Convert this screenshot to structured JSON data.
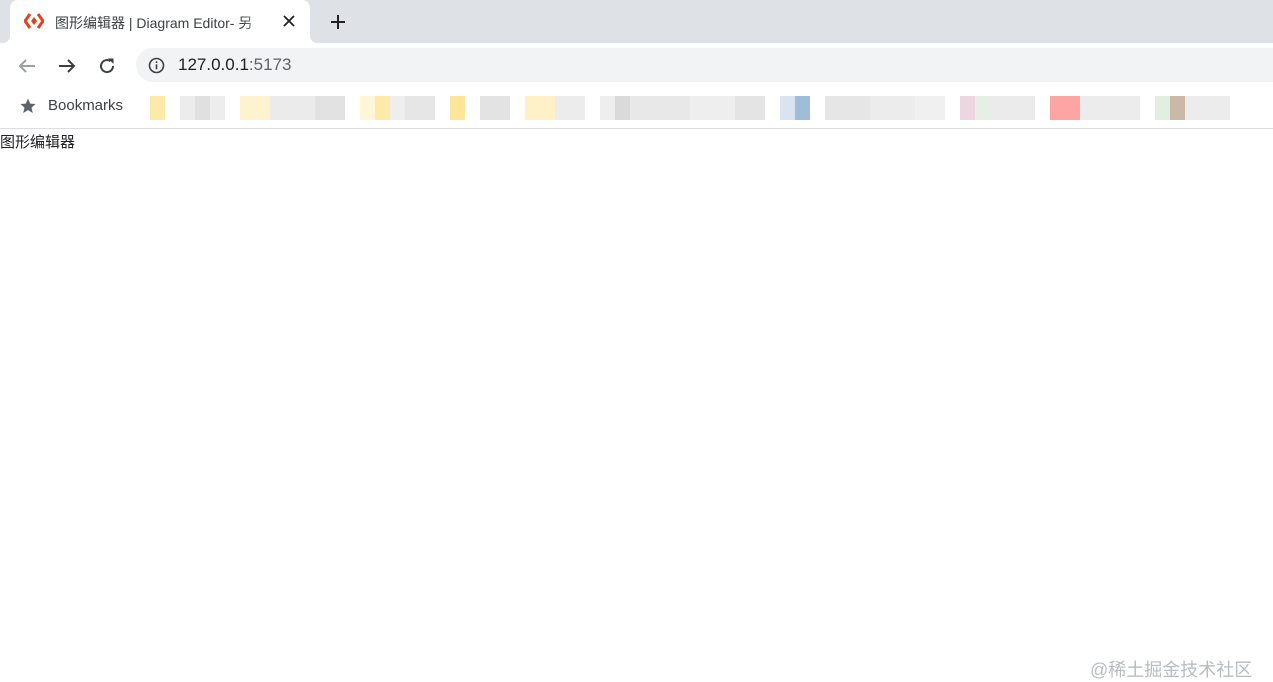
{
  "browser": {
    "tab": {
      "title": "图形编辑器 | Diagram Editor- 另",
      "favicon_icon": "diagram-logo-icon",
      "close_icon": "close-icon"
    },
    "new_tab_icon": "plus-icon",
    "toolbar": {
      "back_icon": "arrow-left-icon",
      "forward_icon": "arrow-right-icon",
      "reload_icon": "reload-icon",
      "site_info_icon": "info-icon",
      "url_host": "127.0.0.1",
      "url_port": ":5173"
    },
    "bookmarks_bar": {
      "star_icon": "star-icon",
      "label": "Bookmarks",
      "items_note_blurred": true
    }
  },
  "page": {
    "heading": "图形编辑器"
  },
  "watermark": "@稀土掘金技术社区",
  "colors": {
    "tabstrip": "#dee1e6",
    "omnibox": "#f1f3f4",
    "favicon": "#e8401c",
    "icon": "#5f6368"
  }
}
